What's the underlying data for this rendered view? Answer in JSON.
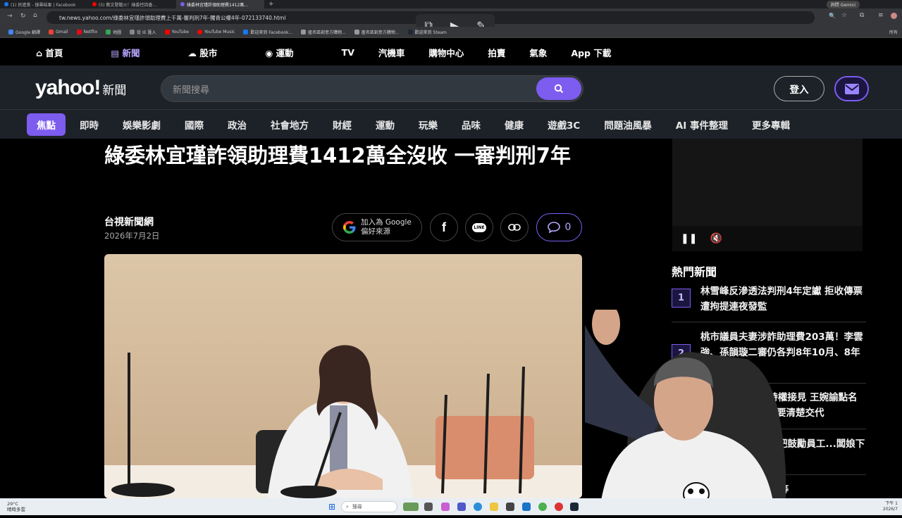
{
  "browser": {
    "tabs": [
      {
        "label": "(1) 民進黨 - 搜尋結果 | Facebook",
        "color": "#1877f2",
        "active": false
      },
      {
        "label": "(5) 教文發戰火！綠委控囚香...",
        "color": "#ff0000",
        "active": false
      },
      {
        "label": "綠委林宜瑾詐領助理費1412萬...",
        "color": "#7d5cf0",
        "active": true
      }
    ],
    "new_tab": "+",
    "gemini_label": "詢問 Gemini",
    "url": "tw.news.yahoo.com/綠委林宜瑾詐領助理費上千萬-審判刑7年-獨青公權4年-072133740.html",
    "bookmarks": [
      "Google 翻譯",
      "Gmail",
      "Netflix",
      "地圖",
      "從 IE 匯入",
      "YouTube",
      "YouTube Music",
      "歡迎來到 Facebook...",
      "匿名區創意方購物...",
      "匿名區創意方購物...",
      "歡迎來到 Steam"
    ],
    "bookmarks_overflow": "所有"
  },
  "topnav": [
    "首頁",
    "新聞",
    "股市",
    "運動",
    "TV",
    "汽機車",
    "購物中心",
    "拍賣",
    "氣象",
    "App 下載"
  ],
  "header": {
    "logo": "yahoo!",
    "logo_sub": "新聞",
    "search_placeholder": "新聞搜尋",
    "login": "登入"
  },
  "categories": [
    "焦點",
    "即時",
    "娛樂影劇",
    "國際",
    "政治",
    "社會地方",
    "財經",
    "運動",
    "玩樂",
    "品味",
    "健康",
    "遊戲3C",
    "問題油風暴",
    "AI 事件整理",
    "更多專輯"
  ],
  "article": {
    "title": "綠委林宜瑾詐領助理費1412萬全沒收 一審判刑7年",
    "source": "台視新聞網",
    "date": "2026年7月2日",
    "google_btn_line1": "加入為 Google",
    "google_btn_line2": "偏好來源",
    "line_label": "LINE",
    "comment_count": "0"
  },
  "hot_news": {
    "title": "熱門新聞",
    "items": [
      {
        "num": "1",
        "text": "林雪峰反滲透法判刑4年定讞 拒收傳票遭拘提連夜發監"
      },
      {
        "num": "2",
        "text": "桃市議員夫妻涉詐助理費203萬！李雲強、孫韻璇二審仍各判8年10月、8年"
      },
      {
        "num": "3",
        "text": "...憶詐騙首腦獲特權接見 王婉諭點名立委：台灣人民需要清楚交代"
      },
      {
        "num": "4",
        "text": "...！信義區知名酒吧鼓勵員工...闆娘下場曝光了"
      },
      {
        "num": "5",
        "text": "...剛滿月...陸軍二等"
      }
    ]
  },
  "taskbar": {
    "weather_temp": "29°C",
    "weather_desc": "晴時多雲",
    "search": "搜尋",
    "time": "下午 1",
    "date": "2026/7"
  },
  "colors": {
    "accent": "#7d5cf0",
    "header_bg": "#1d2228"
  }
}
